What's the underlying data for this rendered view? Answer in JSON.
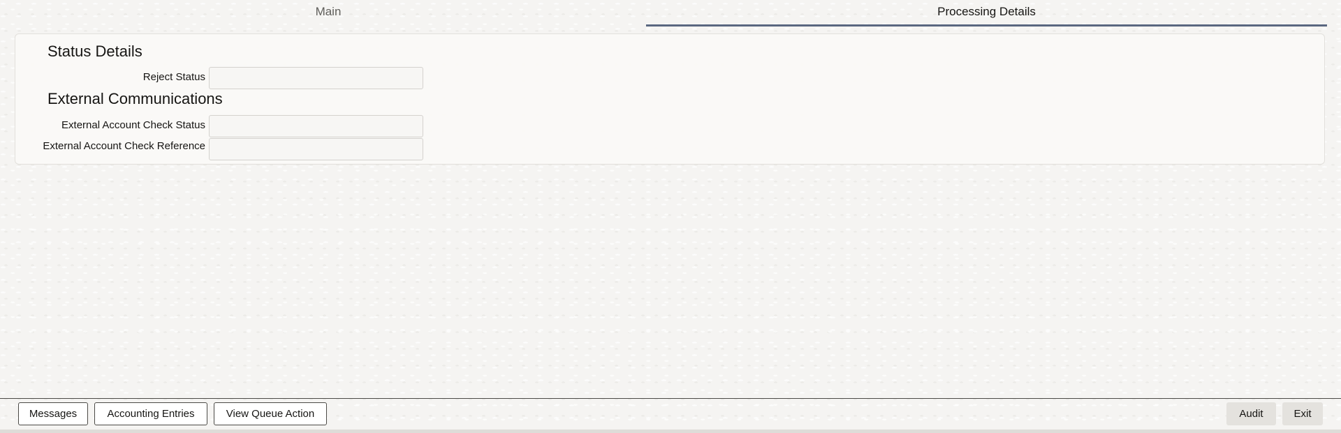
{
  "tabs": {
    "main": "Main",
    "processing": "Processing Details",
    "active_tab": "Processing Details"
  },
  "status_details": {
    "heading": "Status Details",
    "reject_status_label": "Reject Status",
    "reject_status_value": ""
  },
  "external_communications": {
    "heading": "External Communications",
    "account_check_status_label": "External Account Check Status",
    "account_check_status_value": "",
    "account_check_reference_label": "External Account Check Reference",
    "account_check_reference_value": ""
  },
  "footer": {
    "messages": "Messages",
    "accounting_entries": "Accounting Entries",
    "view_queue_action": "View Queue Action",
    "audit": "Audit",
    "exit": "Exit"
  },
  "colors": {
    "active_tab_underline": "#5a6780",
    "text": "#161513",
    "inactive_tab_text": "#5f5e5a"
  }
}
